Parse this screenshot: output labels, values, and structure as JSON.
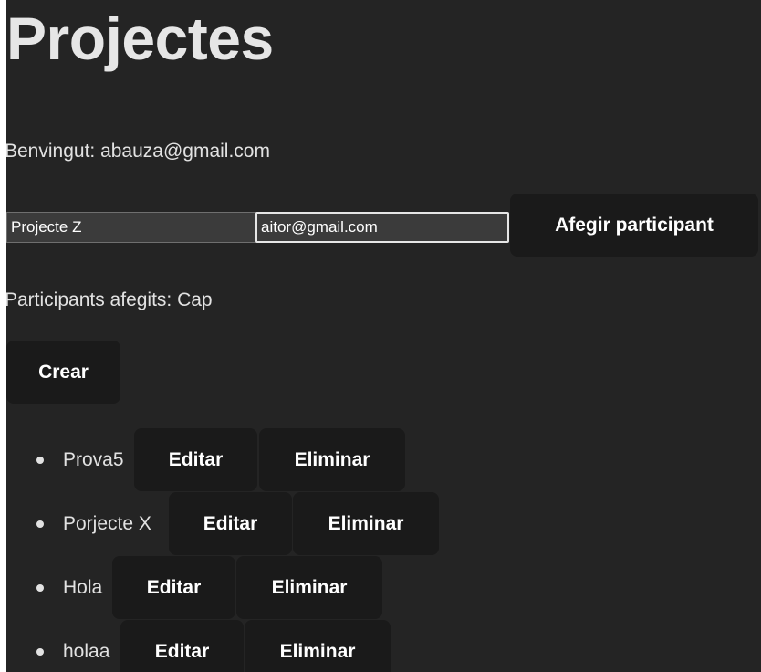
{
  "page": {
    "title": "Projectes",
    "welcome": "Benvingut: abauza@gmail.com"
  },
  "form": {
    "project_name_value": "Projecte Z",
    "participant_email_value": "aitor@gmail.com",
    "add_participant_label": "Afegir participant",
    "participants_text": "Participants afegits: Cap",
    "create_label": "Crear"
  },
  "projects": [
    {
      "name": "Prova5",
      "edit_label": "Editar",
      "delete_label": "Eliminar"
    },
    {
      "name": "Porjecte X",
      "edit_label": "Editar",
      "delete_label": "Eliminar"
    },
    {
      "name": "Hola",
      "edit_label": "Editar",
      "delete_label": "Eliminar"
    },
    {
      "name": "holaa",
      "edit_label": "Editar",
      "delete_label": "Eliminar"
    }
  ],
  "colors": {
    "background": "#242424",
    "button_background": "#1a1a1a",
    "input_background": "#3b3b3b",
    "text": "#ffffff"
  }
}
